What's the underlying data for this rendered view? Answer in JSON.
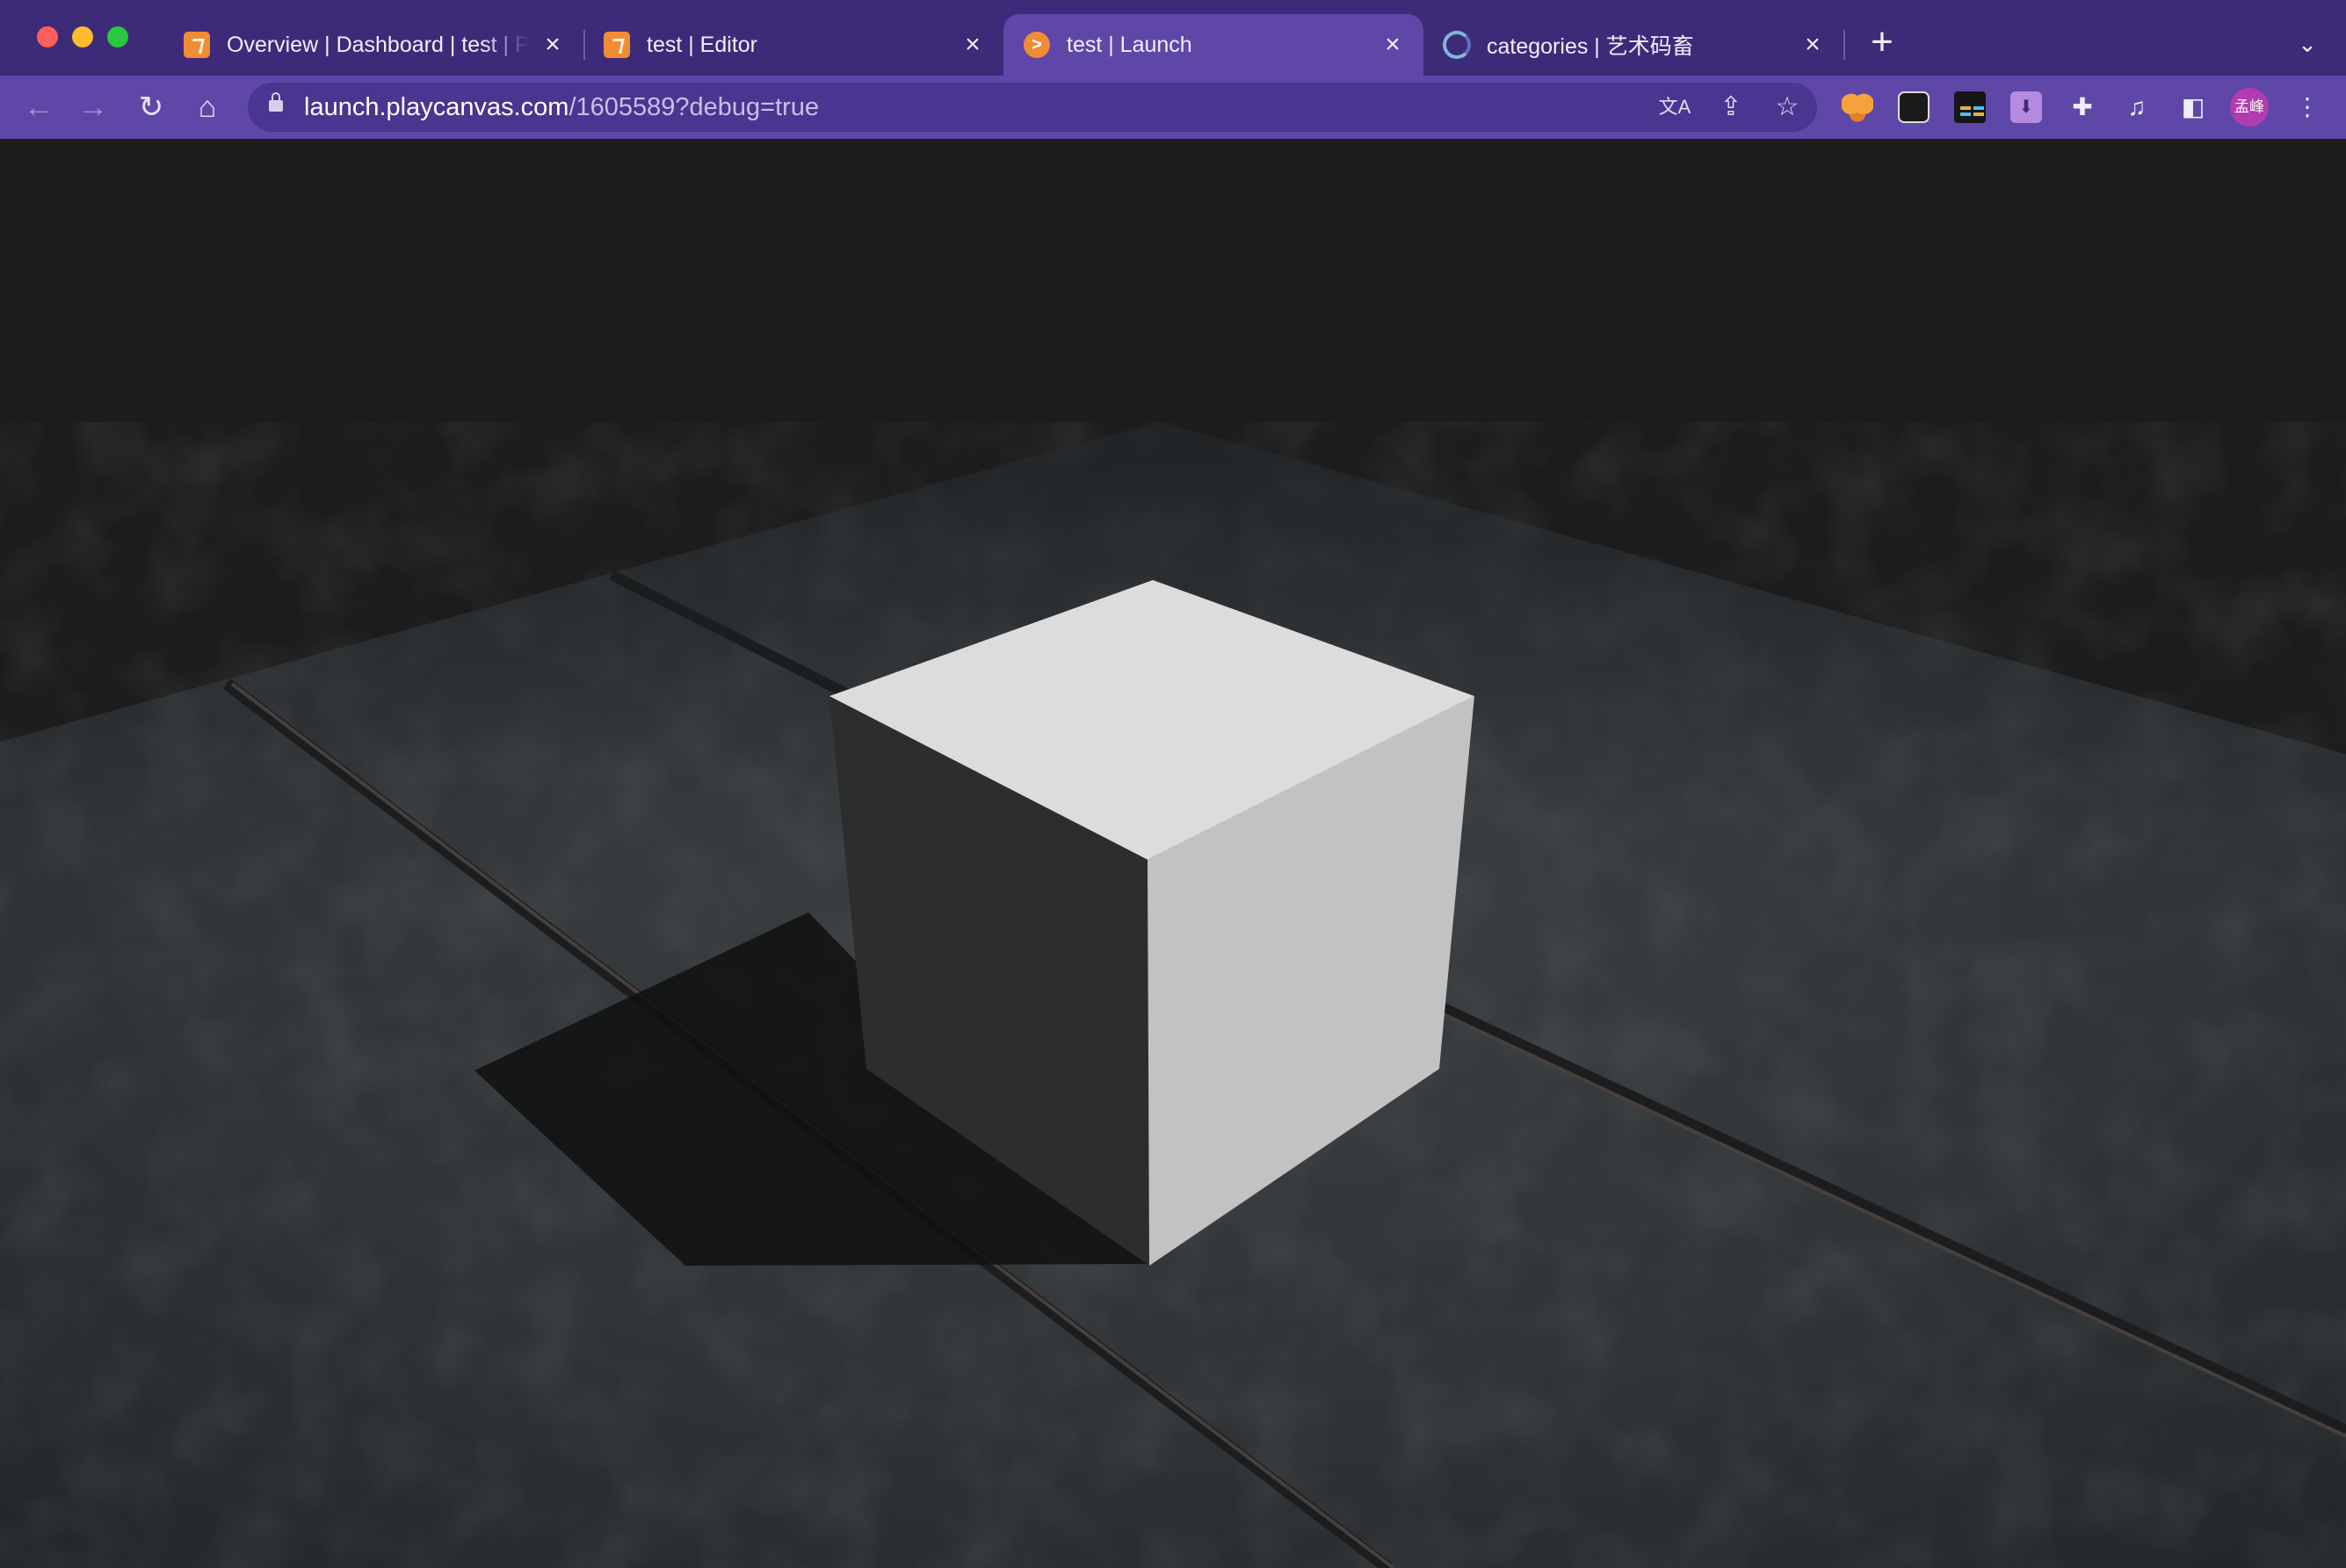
{
  "browser": {
    "tabs": [
      {
        "title": "Overview | Dashboard | test | Pl",
        "favicon": "playcanvas-icon",
        "active": false
      },
      {
        "title": "test | Editor",
        "favicon": "playcanvas-icon",
        "active": false
      },
      {
        "title": "test | Launch",
        "favicon": "launch-icon",
        "active": true
      },
      {
        "title": "categories | 艺术码畜",
        "favicon": "swirl-icon",
        "active": false
      }
    ],
    "new_tab_label": "+",
    "address": {
      "host": "launch.playcanvas.com",
      "path": "/1605589?debug=true"
    },
    "profile_initials": "孟峰"
  },
  "colors": {
    "tabstrip": "#3d2a78",
    "toolbar": "#5f47a8",
    "omnibox": "#4a3590",
    "scene_background": "#1c1c1c",
    "floor": "#33383b",
    "cube_top": "#dcdcdc",
    "cube_right": "#c2c2c2",
    "cube_left": "#2d2d2d"
  },
  "scene": {
    "description_objects": [
      "floor-plane",
      "white-cube",
      "cube-shadow",
      "floor-seams"
    ]
  }
}
